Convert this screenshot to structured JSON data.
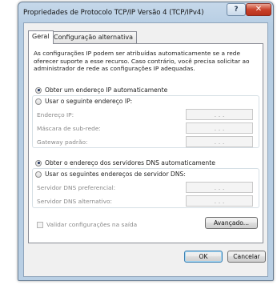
{
  "window": {
    "title": "Propriedades de Protocolo TCP/IP Versão 4 (TCP/IPv4)",
    "help_label": "?",
    "close_label": "✕"
  },
  "tabs": [
    {
      "label": "Geral",
      "active": true
    },
    {
      "label": "Configuração alternativa",
      "active": false
    }
  ],
  "description": "As configurações IP podem ser atribuídas automaticamente se a rede oferecer suporte a esse recurso. Caso contrário, você precisa solicitar ao administrador de rede as configurações IP adequadas.",
  "ip": {
    "auto_label": "Obter um endereço IP automaticamente",
    "auto_selected": true,
    "manual_label": "Usar o seguinte endereço IP:",
    "manual_selected": false,
    "fields": [
      {
        "label": "Endereço IP:",
        "value": ". . ."
      },
      {
        "label": "Máscara de sub-rede:",
        "value": ". . ."
      },
      {
        "label": "Gateway padrão:",
        "value": ". . ."
      }
    ]
  },
  "dns": {
    "auto_label": "Obter o endereço dos servidores DNS automaticamente",
    "auto_selected": true,
    "manual_label": "Usar os seguintes endereços de servidor DNS:",
    "manual_selected": false,
    "fields": [
      {
        "label": "Servidor DNS preferencial:",
        "value": ". . ."
      },
      {
        "label": "Servidor DNS alternativo:",
        "value": ". . ."
      }
    ]
  },
  "validate": {
    "label": "Validar configurações na saída",
    "checked": false
  },
  "buttons": {
    "advanced": "Avançado...",
    "ok": "OK",
    "cancel": "Cancelar"
  },
  "colors": {
    "title_bar": "#b9cfe4",
    "close_button": "#c9422b",
    "panel": "#ffffff"
  }
}
